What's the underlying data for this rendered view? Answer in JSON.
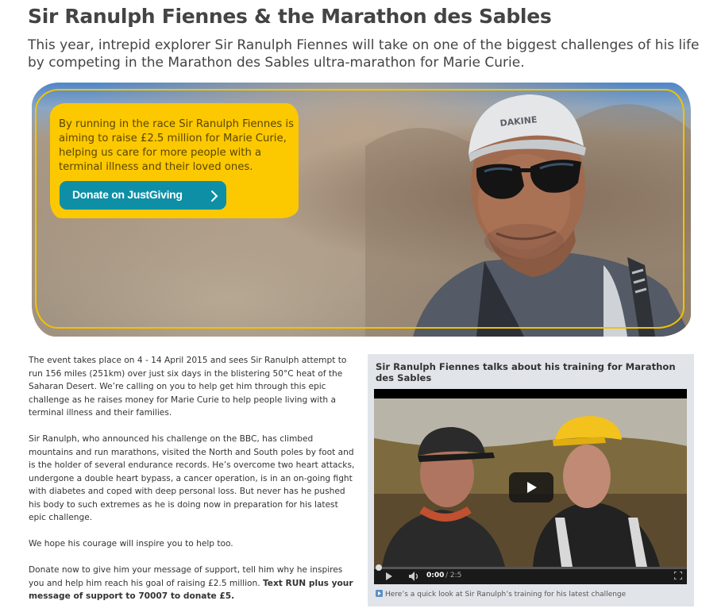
{
  "page": {
    "title": "Sir Ranulph Fiennes & the Marathon des Sables",
    "intro": "This year, intrepid explorer Sir Ranulph Fiennes will take on one of the biggest challenges of his life by competing in the Marathon des Sables ultra-marathon for Marie Curie."
  },
  "hero": {
    "callout_text": "By running in the race Sir Ranulph Fiennes is aiming to raise £2.5 million for Marie Curie, helping us care for more people with a terminal illness and their loved ones.",
    "donate_label": "Donate on JustGiving",
    "cap_logo_text": "DAKINE"
  },
  "article": {
    "p1": "The event takes place on 4 - 14 April 2015 and sees Sir Ranulph attempt to run 156 miles (251km) over just six days in the blistering 50°C heat of the Saharan Desert. We’re calling on you to help get him through this epic challenge as he raises money for Marie Curie to help people living with a terminal illness and their families.",
    "p2": "Sir Ranulph, who announced his challenge on the BBC, has climbed mountains and run marathons, visited the North and South poles by foot and is the holder of several endurance records. He’s overcome two heart attacks, undergone a double heart bypass, a cancer operation, is in an on-going fight with diabetes and coped with deep personal loss. But never has he pushed his body to such extremes as he is doing now in preparation for his latest epic challenge.",
    "p3": "We hope his courage will inspire you to help too.",
    "p4_start": "Donate now to give him your message of support, tell him why he inspires you and help him reach his goal of raising £2.5 million. ",
    "p4_bold": "Text RUN plus your message of support to 70007 to donate £5."
  },
  "video": {
    "title": "Sir Ranulph Fiennes talks about his training for Marathon des Sables",
    "time_current": "0:00",
    "time_total": "/ 2:5",
    "caption": "Here’s a quick look at Sir Ranulph’s training for his latest challenge",
    "progress": 0
  },
  "colors": {
    "brand_yellow": "#fcc800",
    "donate_teal": "#0f8fa6",
    "title_gray": "#444444"
  }
}
